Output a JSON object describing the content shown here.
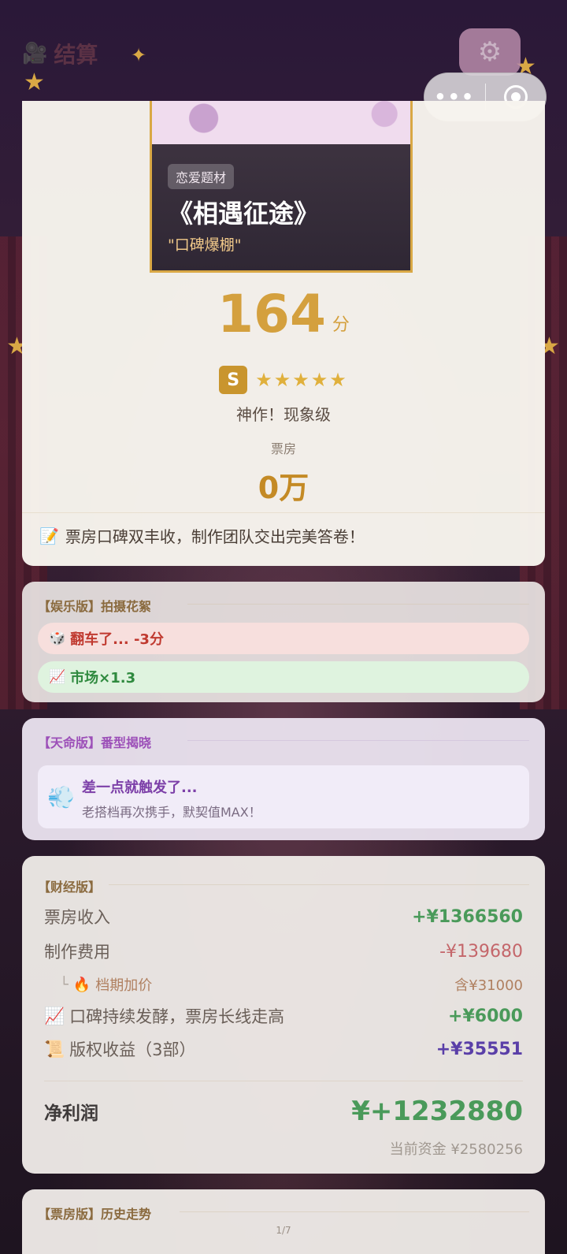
{
  "header": {
    "icon": "film-camera-icon",
    "title": "结算"
  },
  "controls": {
    "gear_icon": "gear-icon",
    "menu_icon": "•••",
    "record_icon": "record-icon"
  },
  "poster": {
    "genre": "恋爱题材",
    "title": "《相遇征途》",
    "tagline": "\"口碑爆棚\""
  },
  "score": {
    "value": "164",
    "unit": "分",
    "grade": "S",
    "stars": "★★★★★",
    "verdict": "神作！现象级",
    "box_office_label": "票房",
    "box_office_value": "0万"
  },
  "summary": {
    "icon": "📝",
    "text": "票房口碑双丰收，制作团队交出完美答卷！"
  },
  "entertainment": {
    "title": "【娱乐版】拍摄花絮",
    "items": [
      {
        "icon": "🎲",
        "text": "翻车了... -3分"
      },
      {
        "icon": "📈",
        "text": "市场×1.3"
      }
    ]
  },
  "fate": {
    "title": "【天命版】番型揭晓",
    "icon": "💨",
    "headline": "差一点就触发了...",
    "detail": "老搭档再次携手，默契值MAX！"
  },
  "finance": {
    "title": "【财经版】",
    "rows": [
      {
        "label": "票房收入",
        "value": "+¥1366560"
      },
      {
        "label": "制作费用",
        "value": "-¥139680"
      },
      {
        "prefix": "└",
        "icon": "🔥",
        "label": "档期加价",
        "value": "含¥31000"
      },
      {
        "icon": "📈",
        "label": "口碑持续发酵，票房长线走高",
        "value": "+¥6000"
      },
      {
        "icon": "📜",
        "label": "版权收益（3部）",
        "value": "+¥35551"
      }
    ],
    "net_label": "净利润",
    "net_value": "¥+1232880",
    "funds": "当前资金 ¥2580256"
  },
  "box_office_history": {
    "title": "【票房版】历史走势"
  },
  "page_indicator": "1/7",
  "colors": {
    "gold": "#d4a03e",
    "profit_green": "#4a9a5a",
    "cost_red": "#c4666a",
    "royalty_purple": "#5a3fa8"
  }
}
